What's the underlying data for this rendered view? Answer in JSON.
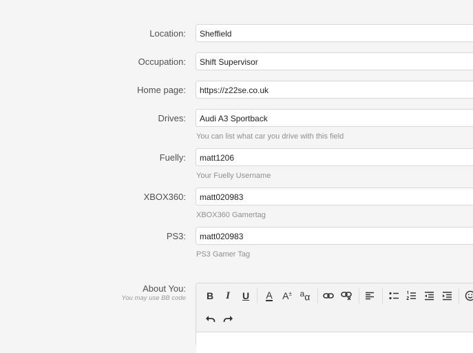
{
  "fields": [
    {
      "label": "Location:",
      "value": "Sheffield"
    },
    {
      "label": "Occupation:",
      "value": "Shift Supervisor"
    },
    {
      "label": "Home page:",
      "value": "https://z22se.co.uk"
    },
    {
      "label": "Drives:",
      "value": "Audi A3 Sportback",
      "hint": "You can list what car you drive with this field"
    },
    {
      "label": "Fuelly:",
      "value": "matt1206",
      "hint": "Your Fuelly Username"
    },
    {
      "label": "XBOX360:",
      "value": "matt020983",
      "hint": "XBOX360 Gamertag"
    },
    {
      "label": "PS3:",
      "value": "matt020983",
      "hint": "PS3 Gamer Tag"
    }
  ],
  "about": {
    "label": "About You:",
    "subhint": "You may use BB code"
  },
  "toolbar": {
    "bold": "B",
    "italic": "I",
    "underline": "U",
    "font_color": "A",
    "font_size": "A",
    "font_size_sup": "±",
    "font_family": "a",
    "font_family_sub": "α"
  }
}
